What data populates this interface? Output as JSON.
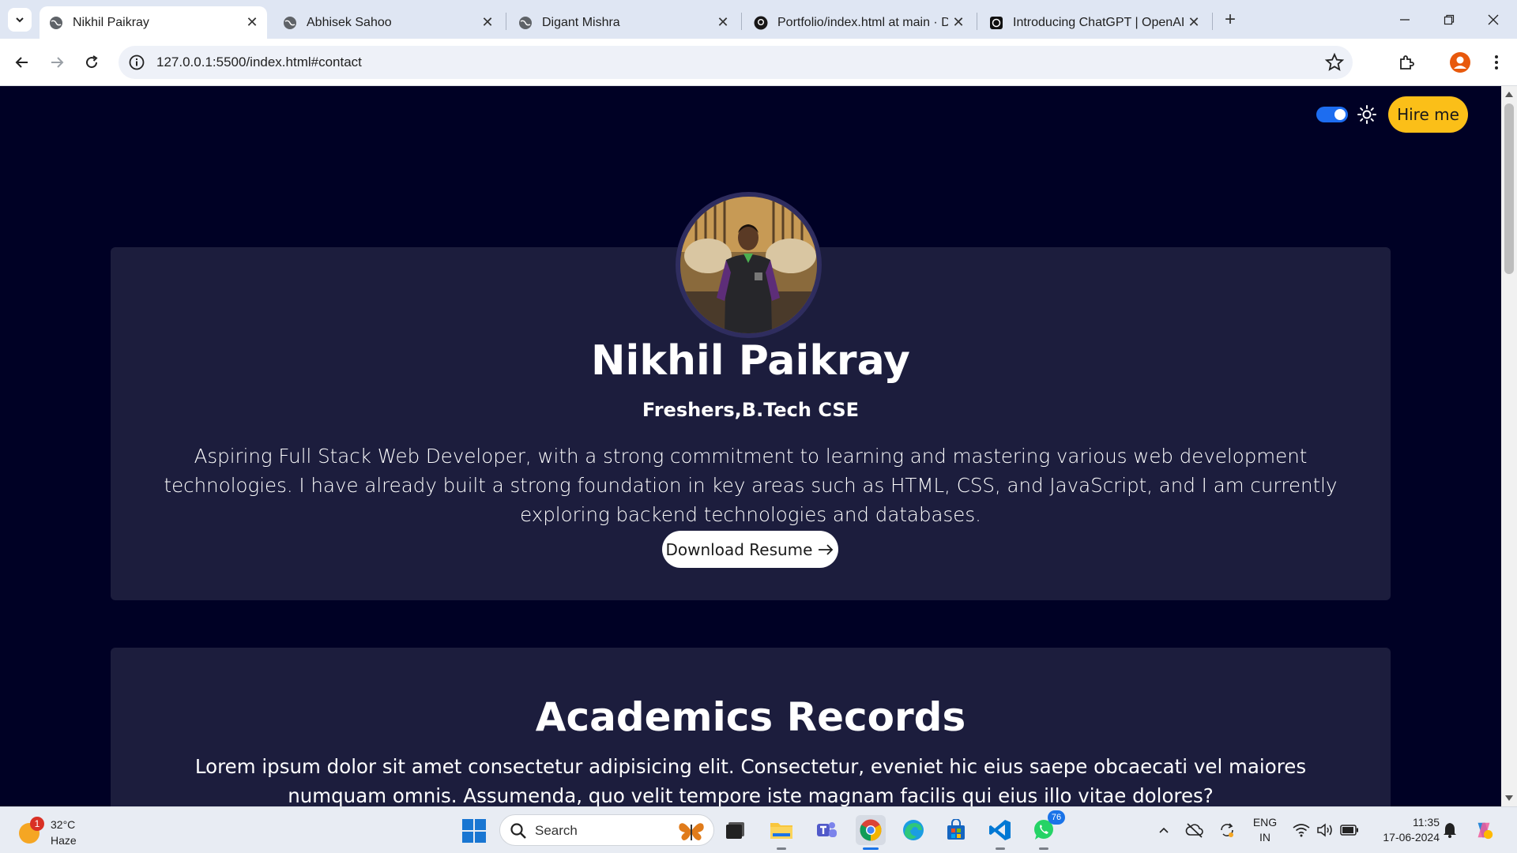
{
  "browser": {
    "tabs": [
      {
        "title": "Nikhil Paikray",
        "active": true,
        "icon": "globe-icon"
      },
      {
        "title": "Abhisek Sahoo",
        "active": false,
        "icon": "globe-icon"
      },
      {
        "title": "Digant Mishra",
        "active": false,
        "icon": "globe-icon"
      },
      {
        "title": "Portfolio/index.html at main · D",
        "active": false,
        "icon": "github-icon"
      },
      {
        "title": "Introducing ChatGPT | OpenAI",
        "active": false,
        "icon": "openai-icon"
      }
    ],
    "url": "127.0.0.1:5500/index.html#contact"
  },
  "page": {
    "hire_label": "Hire me",
    "theme_toggle_on": true,
    "hero": {
      "name": "Nikhil Paikray",
      "subtitle": "Freshers,B.Tech CSE",
      "bio": "Aspiring Full Stack Web Developer, with a strong commitment to learning and mastering various web development technologies. I have already built a strong foundation in key areas such as HTML, CSS, and JavaScript, and I am currently exploring backend technologies and databases.",
      "resume_label": "Download Resume"
    },
    "academics": {
      "title": "Academics Records",
      "text": "Lorem ipsum dolor sit amet consectetur adipisicing elit. Consectetur, eveniet hic eius saepe obcaecati vel maiores numquam omnis. Assumenda, quo velit tempore iste magnam facilis qui eius illo vitae dolores?"
    }
  },
  "taskbar": {
    "weather": {
      "temp": "32°C",
      "condition": "Haze",
      "badge": "1"
    },
    "search_label": "Search",
    "apps": [
      {
        "name": "task-view",
        "icon": "task-view-icon"
      },
      {
        "name": "file-explorer",
        "icon": "folder-icon"
      },
      {
        "name": "teams",
        "icon": "teams-icon"
      },
      {
        "name": "chrome",
        "icon": "chrome-icon",
        "active": true
      },
      {
        "name": "edge",
        "icon": "edge-icon"
      },
      {
        "name": "store",
        "icon": "store-icon"
      },
      {
        "name": "vscode",
        "icon": "vscode-icon"
      },
      {
        "name": "whatsapp",
        "icon": "whatsapp-icon",
        "badge": "76"
      }
    ],
    "language": {
      "line1": "ENG",
      "line2": "IN"
    },
    "clock": {
      "time": "11:35",
      "date": "17-06-2024"
    }
  },
  "colors": {
    "page_bg": "#000125",
    "card_bg": "#1c1d3d",
    "accent_yellow": "#fbbf18",
    "toggle_blue": "#1d6df0"
  }
}
